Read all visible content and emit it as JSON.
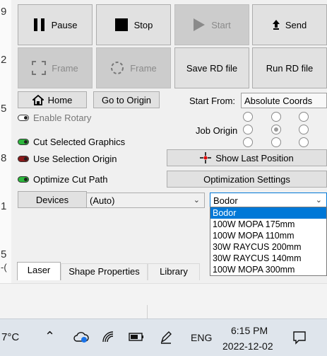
{
  "gutter": [
    "9",
    "2",
    "5",
    "8",
    "1",
    "5",
    "-("
  ],
  "controls": {
    "pause": "Pause",
    "stop": "Stop",
    "start": "Start",
    "send": "Send",
    "frame1": "Frame",
    "frame2": "Frame",
    "save_rd": "Save RD file",
    "run_rd": "Run RD file"
  },
  "nav": {
    "home": "Home",
    "go_origin": "Go to Origin"
  },
  "start_from": {
    "label": "Start From:",
    "value": "Absolute Coords"
  },
  "job_origin": {
    "label": "Job Origin",
    "selected_index": 4
  },
  "options": {
    "enable_rotary": "Enable Rotary",
    "cut_selected": "Cut Selected Graphics",
    "use_selection_origin": "Use Selection Origin",
    "optimize_cut": "Optimize Cut Path"
  },
  "led_colors": {
    "off": "#333333",
    "green": "#2db83d",
    "red": "#8b1a1a"
  },
  "show_last_position": "Show Last Position",
  "optimization_settings": "Optimization Settings",
  "devices": {
    "label": "Devices",
    "port": "(Auto)",
    "device": "Bodor"
  },
  "device_options": [
    "Bodor",
    "100W MOPA 175mm",
    "100W MOPA 110mm",
    "30W RAYCUS 200mm",
    "30W RAYCUS 140mm",
    "100W MOPA 300mm"
  ],
  "tabs": [
    "Laser",
    "Shape Properties",
    "Library"
  ],
  "taskbar": {
    "temp": "7°C",
    "lang": "ENG",
    "time": "6:15 PM",
    "date": "2022-12-02"
  }
}
